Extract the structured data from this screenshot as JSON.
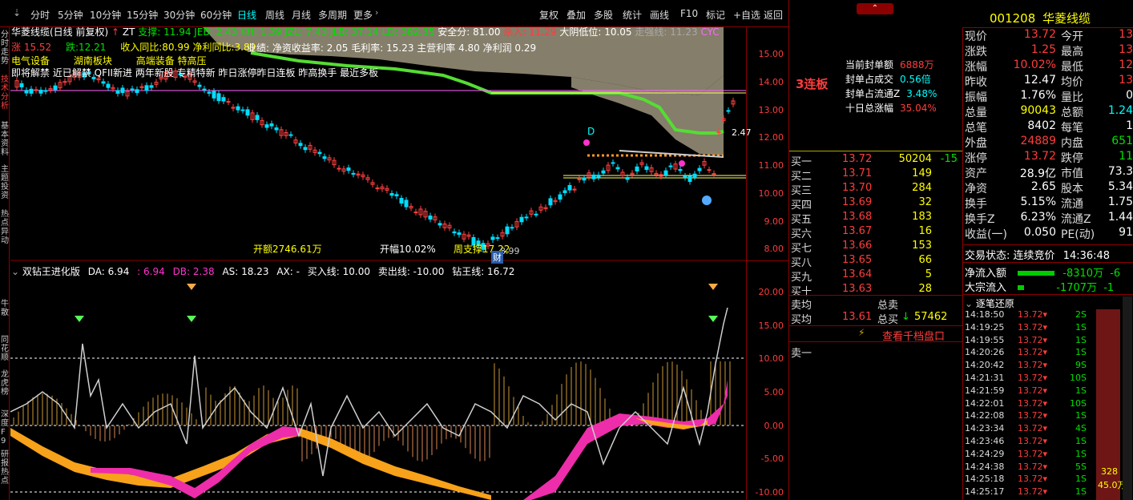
{
  "toolbar": {
    "left_items": [
      "分时",
      "5分钟",
      "10分钟",
      "15分钟",
      "30分钟",
      "60分钟",
      "日线",
      "周线",
      "月线",
      "多周期",
      "更多"
    ],
    "right_items": [
      "复权",
      "叠加",
      "多股",
      "统计",
      "画线",
      "F10",
      "标记",
      "+自选",
      "返回"
    ],
    "active": "日线"
  },
  "left_strip": [
    "分时走势",
    "技术分析",
    "基本资料",
    "主题投资",
    "热点异动",
    "牛散",
    "同花顺",
    "龙虎榜",
    "深度F9",
    "研报热点"
  ],
  "main_chart": {
    "title": "华菱线缆(日线 前复权)",
    "zt_label": "ZT",
    "indicators": "支撑: 11.94 JEB: 2.43 KH: 1.39 JZL: 7.43 JLB: 37.14 LD: 382.35",
    "safety": "安全分: 81.00",
    "kill": "杀入: 11.29",
    "big_yin": "大阴低位: 10.05",
    "trend": "走强线: 11.23",
    "cyc": "CYC",
    "info_high": "涨 15.52",
    "info_fall": "跌:12.21",
    "revenue_growth": "收入同比:80.99",
    "profit_growth": "净利同比:3.89",
    "performance": "业绩: 净资收益率: 2.05 毛利率: 15.23 主营利率 4.80 净利润 0.29",
    "concept1": "电气设备",
    "concept2": "湖南板块",
    "concept3": "高端装备 特高压",
    "tags": "即将解禁 近已解禁 QFII新进 两年新股 专精特新 昨日涨停昨日连板 昨高换手 最近多板",
    "open_amount": "开额2746.61万",
    "open_pct": "开幅10.02%",
    "weekly_support": "周支撑17.22",
    "low_price": "8.99",
    "cai": "财",
    "d_label": "D",
    "right_val": "2.47",
    "price_ticks": [
      "15.00",
      "14.00",
      "13.00",
      "12.00",
      "11.00",
      "10.00",
      "9.00",
      "8.00"
    ]
  },
  "sub_chart": {
    "title": "双钻王进化版",
    "da": "DA: 6.94",
    "da2": ": 6.94",
    "db": "DB: 2.38",
    "as": "AS: 18.23",
    "ax": "AX: -",
    "buy_line": "买入线: 10.00",
    "sell_line": "卖出线: -10.00",
    "diamond_line": "钻王线: 16.72",
    "ticks": [
      "20.00",
      "15.00",
      "10.00",
      "5.00",
      "0.00",
      "-5.00",
      "-10.00"
    ]
  },
  "stock": {
    "code": "001208",
    "name": "华菱线缆",
    "board": "3连板",
    "seal_amount_label": "当前封单额",
    "seal_amount": "6888万",
    "seal_ratio_label": "封单占成交",
    "seal_ratio": "0.56倍",
    "seal_float_label": "封单占流通Z",
    "seal_float": "3.48%",
    "ten_day_label": "十日总涨幅",
    "ten_day": "35.04%"
  },
  "quote": [
    {
      "l1": "现价",
      "v1": "13.72",
      "l2": "今开",
      "v2": "13"
    },
    {
      "l1": "涨跌",
      "v1": "1.25",
      "l2": "最高",
      "v2": "13"
    },
    {
      "l1": "涨幅",
      "v1": "10.02%",
      "l2": "最低",
      "v2": "12"
    },
    {
      "l1": "昨收",
      "v1": "12.47",
      "l2": "均价",
      "v2": "13"
    },
    {
      "l1": "振幅",
      "v1": "1.76%",
      "l2": "量比",
      "v2": "0"
    },
    {
      "l1": "总量",
      "v1": "90043",
      "l2": "总额",
      "v2": "1.24"
    },
    {
      "l1": "总笔",
      "v1": "8402",
      "l2": "每笔",
      "v2": "1"
    },
    {
      "l1": "外盘",
      "v1": "24889",
      "l2": "内盘",
      "v2": "651"
    },
    {
      "l1": "涨停",
      "v1": "13.72",
      "l2": "跌停",
      "v2": "11"
    },
    {
      "l1": "资产",
      "v1": "28.9亿",
      "l2": "市值",
      "v2": "73.3"
    },
    {
      "l1": "净资",
      "v1": "2.65",
      "l2": "股本",
      "v2": "5.34"
    },
    {
      "l1": "换手",
      "v1": "5.15%",
      "l2": "流通",
      "v2": "1.75"
    },
    {
      "l1": "换手Z",
      "v1": "6.23%",
      "l2": "流通Z",
      "v2": "1.44"
    },
    {
      "l1": "收益(一)",
      "v1": "0.050",
      "l2": "PE(动)",
      "v2": "91"
    }
  ],
  "trade_status": {
    "label": "交易状态:",
    "value": "连续竞价",
    "time": "14:36:48"
  },
  "net_inflow": {
    "label": "净流入额",
    "value": "-8310万",
    "extra": "-6"
  },
  "block_inflow": {
    "label": "大宗流入",
    "value": "-1707万",
    "extra": "-1"
  },
  "order_book": [
    {
      "label": "买一",
      "price": "13.72",
      "vol": "50204",
      "chg": "-15"
    },
    {
      "label": "买二",
      "price": "13.71",
      "vol": "149",
      "chg": ""
    },
    {
      "label": "买三",
      "price": "13.70",
      "vol": "284",
      "chg": ""
    },
    {
      "label": "买四",
      "price": "13.69",
      "vol": "32",
      "chg": ""
    },
    {
      "label": "买五",
      "price": "13.68",
      "vol": "183",
      "chg": ""
    },
    {
      "label": "买六",
      "price": "13.67",
      "vol": "16",
      "chg": ""
    },
    {
      "label": "买七",
      "price": "13.66",
      "vol": "153",
      "chg": ""
    },
    {
      "label": "买八",
      "price": "13.65",
      "vol": "66",
      "chg": ""
    },
    {
      "label": "买九",
      "price": "13.64",
      "vol": "5",
      "chg": ""
    },
    {
      "label": "买十",
      "price": "13.63",
      "vol": "28",
      "chg": ""
    }
  ],
  "sell_avg_label": "卖均",
  "sell_total_label": "总卖",
  "buy_avg_label": "买均",
  "buy_avg": "13.61",
  "buy_total_label": "总买",
  "buy_total": "57462",
  "view_depth": "查看千档盘口",
  "sell_one": "卖一",
  "trades_title": "逐笔还原",
  "trades": [
    {
      "time": "14:18:50",
      "price": "13.72",
      "vol": "2S"
    },
    {
      "time": "14:19:25",
      "price": "13.72",
      "vol": "1S"
    },
    {
      "time": "14:19:55",
      "price": "13.72",
      "vol": "1S"
    },
    {
      "time": "14:20:26",
      "price": "13.72",
      "vol": "1S"
    },
    {
      "time": "14:20:42",
      "price": "13.72",
      "vol": "9S"
    },
    {
      "time": "14:21:31",
      "price": "13.72",
      "vol": "10S"
    },
    {
      "time": "14:21:59",
      "price": "13.72",
      "vol": "1S"
    },
    {
      "time": "14:22:01",
      "price": "13.72",
      "vol": "10S"
    },
    {
      "time": "14:22:08",
      "price": "13.72",
      "vol": "1S"
    },
    {
      "time": "14:23:34",
      "price": "13.72",
      "vol": "4S"
    },
    {
      "time": "14:23:46",
      "price": "13.72",
      "vol": "1S"
    },
    {
      "time": "14:24:29",
      "price": "13.72",
      "vol": "1S"
    },
    {
      "time": "14:24:38",
      "price": "13.72",
      "vol": "5S"
    },
    {
      "time": "14:25:18",
      "price": "13.72",
      "vol": "1S"
    },
    {
      "time": "14:25:17",
      "price": "13.72",
      "vol": "1S"
    }
  ],
  "side_bar": {
    "v1": "328",
    "v2": "45.0万"
  }
}
